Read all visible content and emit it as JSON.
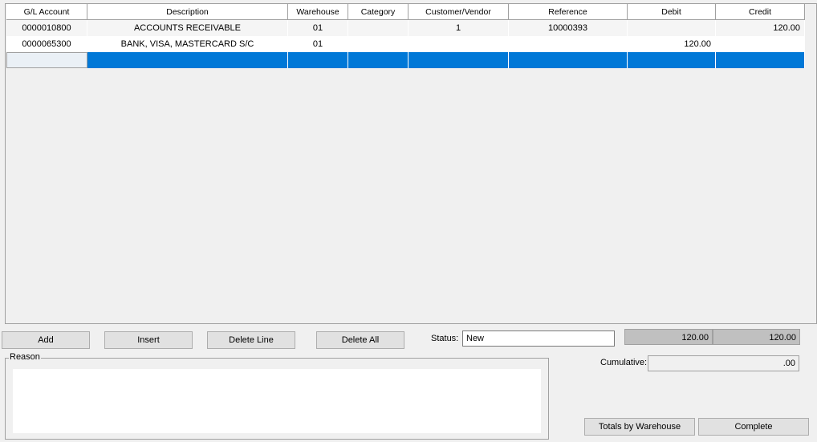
{
  "grid": {
    "columns": [
      "G/L Account",
      "Description",
      "Warehouse",
      "Category",
      "Customer/Vendor",
      "Reference",
      "Debit",
      "Credit"
    ],
    "rows": [
      {
        "gl_account": "0000010800",
        "description": "ACCOUNTS RECEIVABLE",
        "warehouse": "01",
        "category": "",
        "customer_vendor": "1",
        "reference": "10000393",
        "debit": "",
        "credit": "120.00"
      },
      {
        "gl_account": "0000065300",
        "description": "BANK, VISA, MASTERCARD S/C",
        "warehouse": "01",
        "category": "",
        "customer_vendor": "",
        "reference": "",
        "debit": "120.00",
        "credit": ""
      }
    ]
  },
  "buttons": {
    "add": "Add",
    "insert": "Insert",
    "delete_line": "Delete Line",
    "delete_all": "Delete All",
    "totals_by_warehouse": "Totals by Warehouse",
    "complete": "Complete"
  },
  "status": {
    "label": "Status:",
    "value": "New"
  },
  "totals": {
    "debit": "120.00",
    "credit": "120.00"
  },
  "cumulative": {
    "label": "Cumulative:",
    "value": ".00"
  },
  "reason": {
    "title": "Reason",
    "value": ""
  },
  "colors": {
    "selection": "#0078d7",
    "total_bg": "#c0c0c0"
  }
}
